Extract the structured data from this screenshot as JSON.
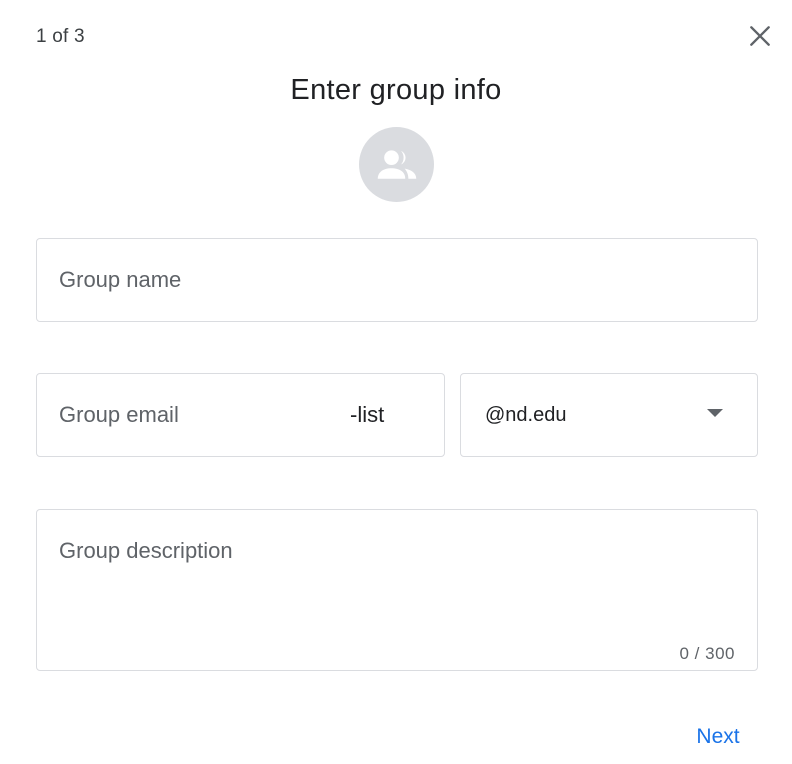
{
  "dialog": {
    "step_indicator": "1 of 3",
    "title": "Enter group info",
    "close_icon": "close-icon",
    "avatar_icon": "group-icon"
  },
  "form": {
    "group_name": {
      "placeholder": "Group name",
      "value": ""
    },
    "group_email": {
      "placeholder": "Group email",
      "value": "",
      "suffix": "-list"
    },
    "domain": {
      "selected": "@nd.edu"
    },
    "description": {
      "placeholder": "Group description",
      "value": "",
      "counter": "0 / 300"
    }
  },
  "actions": {
    "next_label": "Next"
  },
  "colors": {
    "accent": "#1a73e8",
    "border": "#dadce0",
    "avatar_bg": "#dadce0",
    "icon": "#5f6368"
  }
}
